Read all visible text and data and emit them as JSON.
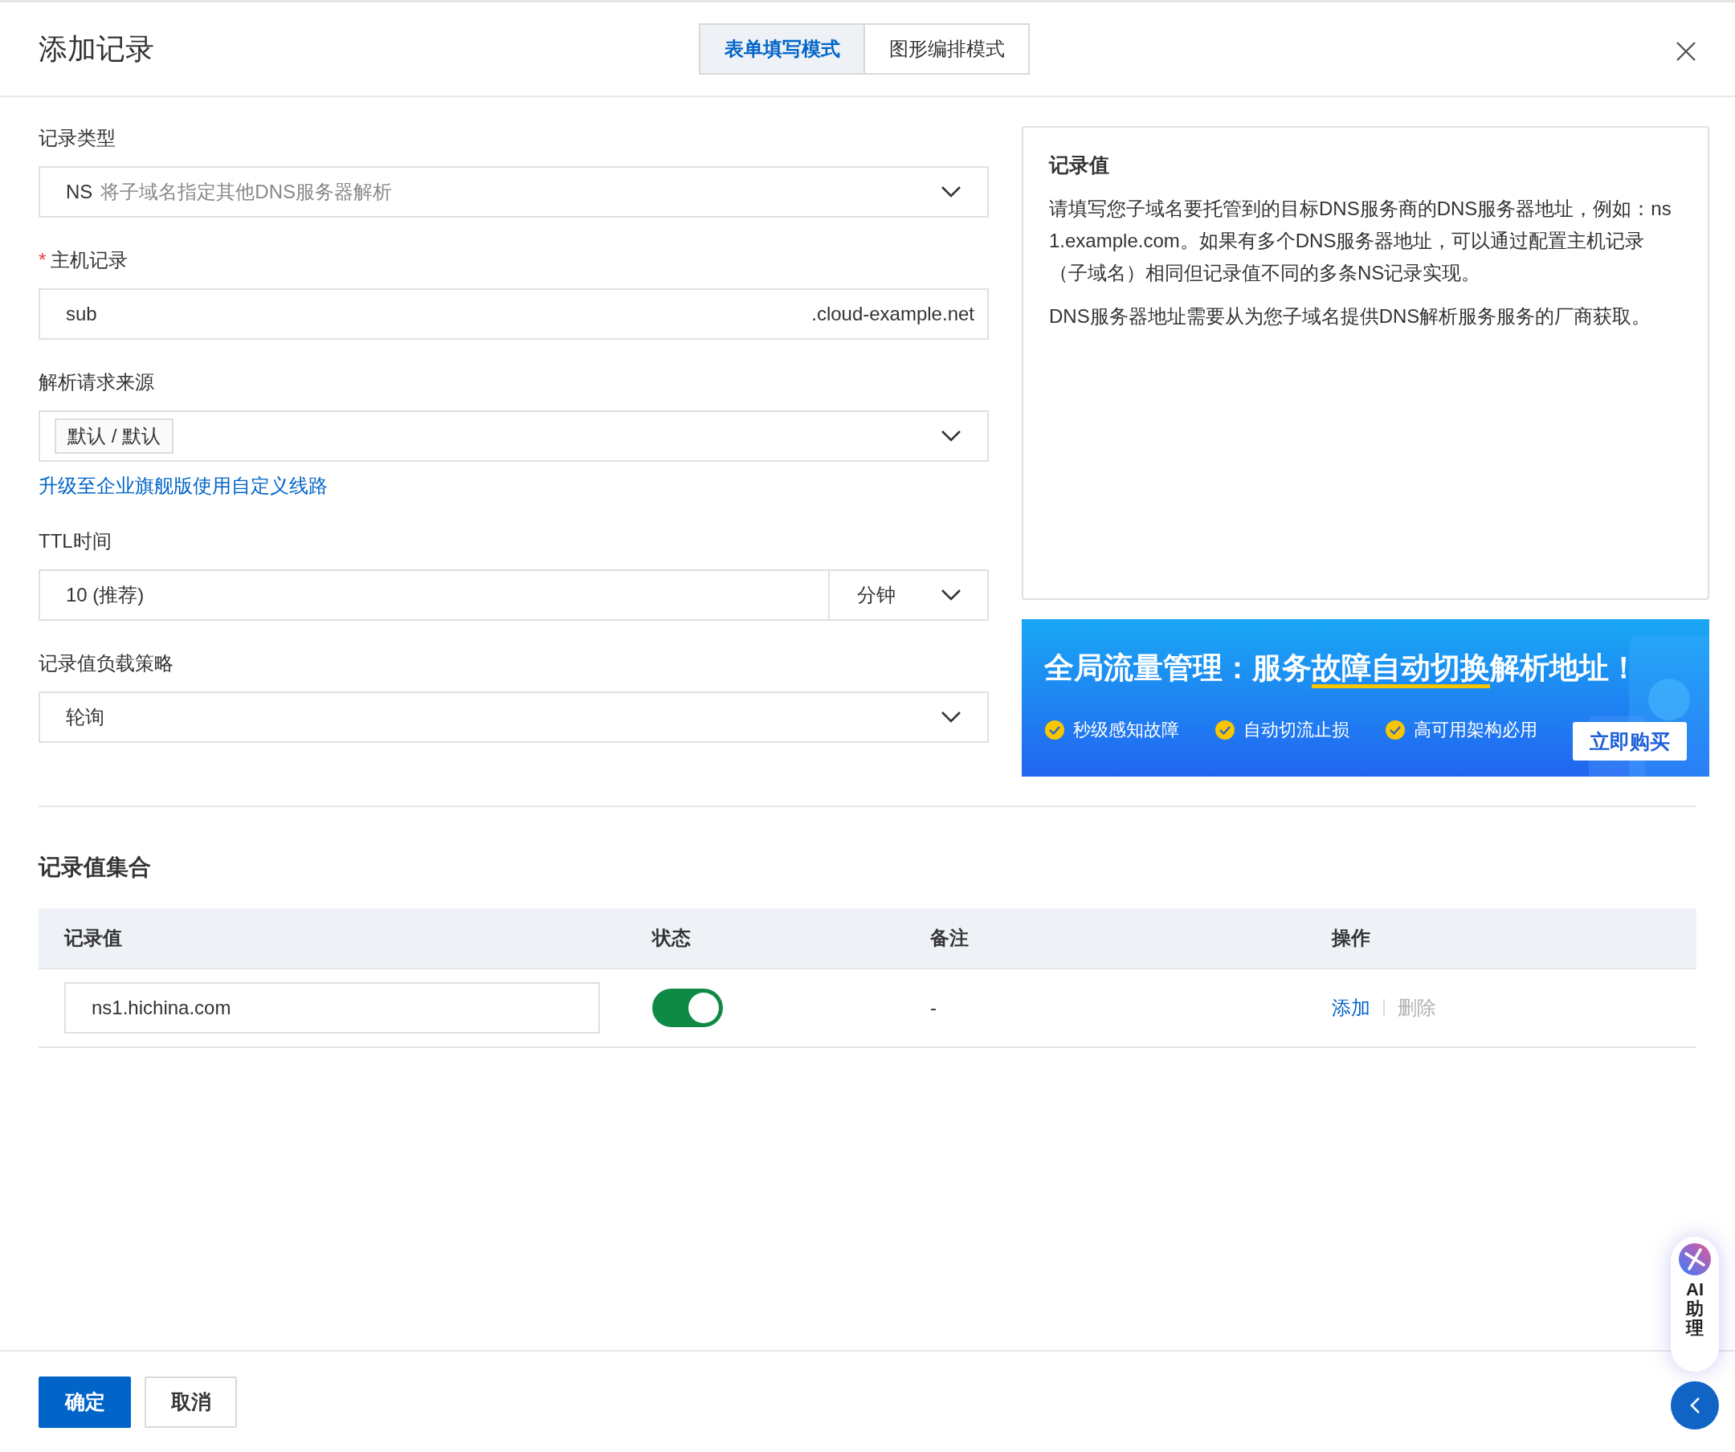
{
  "dialog": {
    "title": "添加记录"
  },
  "mode_tabs": [
    {
      "label": "表单填写模式",
      "selected": true
    },
    {
      "label": "图形编排模式",
      "selected": false
    }
  ],
  "form": {
    "record_type": {
      "label": "记录类型",
      "value": "NS",
      "description": "将子域名指定其他DNS服务器解析"
    },
    "host_record": {
      "label": "主机记录",
      "required_mark": "*",
      "value": "sub",
      "suffix": ".cloud-example.net"
    },
    "request_source": {
      "label": "解析请求来源",
      "tag": "默认 / 默认",
      "link": "升级至企业旗舰版使用自定义线路"
    },
    "ttl": {
      "label": "TTL时间",
      "value": "10 (推荐)",
      "unit": "分钟"
    },
    "load_strategy": {
      "label": "记录值负载策略",
      "value": "轮询"
    }
  },
  "info_panel": {
    "title": "记录值",
    "paragraphs": [
      "请填写您子域名要托管到的目标DNS服务商的DNS服务器地址，例如：ns1.example.com。如果有多个DNS服务器地址，可以通过配置主机记录（子域名）相同但记录值不同的多条NS记录实现。",
      "DNS服务器地址需要从为您子域名提供DNS解析服务服务的厂商获取。"
    ]
  },
  "banner": {
    "title_before": "全局流量管理：服务",
    "title_underlined": "故障自动切换",
    "title_after": "解析地址！",
    "features": [
      "秒级感知故障",
      "自动切流止损",
      "高可用架构必用"
    ],
    "button": "立即购买"
  },
  "record_set": {
    "title": "记录值集合",
    "columns": [
      "记录值",
      "状态",
      "备注",
      "操作"
    ],
    "rows": [
      {
        "value": "ns1.hichina.com",
        "enabled": true,
        "note": "-",
        "actions": [
          {
            "label": "添加",
            "disabled": false
          },
          {
            "label": "删除",
            "disabled": true
          }
        ]
      }
    ]
  },
  "footer": {
    "buttons": [
      {
        "label": "确定",
        "kind": "primary"
      },
      {
        "label": "取消",
        "kind": "default"
      }
    ]
  },
  "assistant": {
    "label": "AI助理"
  }
}
